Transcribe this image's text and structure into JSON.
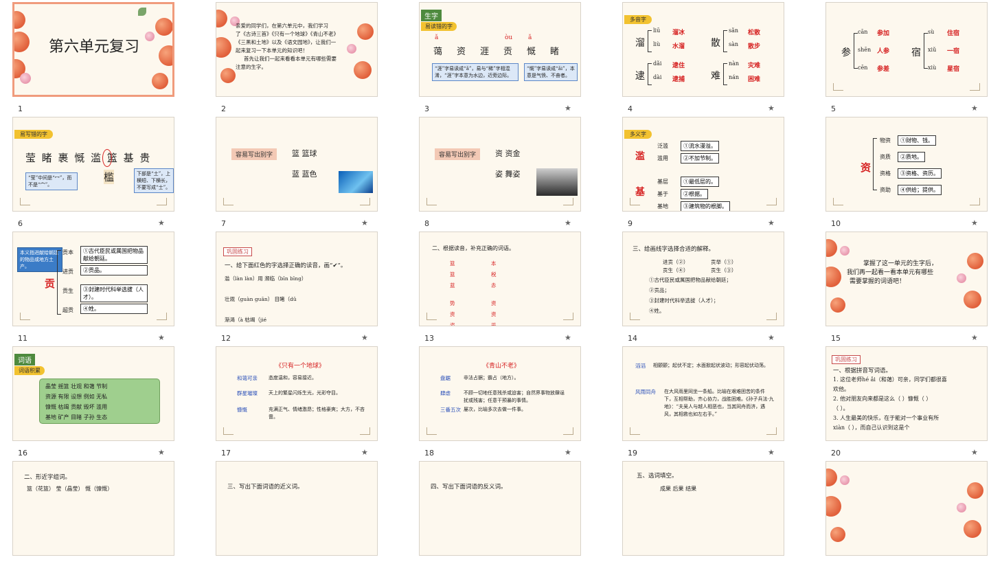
{
  "slides": [
    {
      "number": "1",
      "title": "第六单元复习",
      "selected": true
    },
    {
      "number": "2",
      "lines": [
        "亲爱的同学们，在第六单元中，我们学习",
        "了《古诗三首》《只有一个地球》《青山不老》",
        "《三黑和土地》以及《语文园地》，让我们一",
        "起来复习一下本单元的知识吧！",
        "首先让我们一起来看看本单元有哪些需要",
        "注意的生字。"
      ]
    },
    {
      "number": "3",
      "tag": "生字",
      "subtag": "易读错的字",
      "pinyin": [
        "ǎ",
        "",
        "",
        "òu",
        "ǎ",
        ""
      ],
      "chars": [
        "蔼",
        "资",
        "涯",
        "贡",
        "慨",
        "睹"
      ],
      "note1": "“涯”字易读成“ǎ”，易与“稀”字相混淆，“涯”字本意为水边，近旁边际。",
      "note2": "“慨”字易读成“ǎi”，本意是气愤、不奋者。"
    },
    {
      "number": "4",
      "tag": "多音字",
      "groups": [
        {
          "char": "溜",
          "items": [
            {
              "py": "liū",
              "word": "溜冰"
            },
            {
              "py": "liù",
              "word": "水溜"
            }
          ]
        },
        {
          "char": "散",
          "items": [
            {
              "py": "sǎn",
              "word": "松散"
            },
            {
              "py": "sàn",
              "word": "散步"
            }
          ]
        },
        {
          "char": "逮",
          "items": [
            {
              "py": "dǎi",
              "word": "逮住"
            },
            {
              "py": "dài",
              "word": "逮捕"
            }
          ]
        },
        {
          "char": "难",
          "items": [
            {
              "py": "nàn",
              "word": "灾难"
            },
            {
              "py": "nán",
              "word": "困难"
            }
          ]
        }
      ]
    },
    {
      "number": "5",
      "groups": [
        {
          "char": "参",
          "items": [
            {
              "py": "cān",
              "word": "参加"
            },
            {
              "py": "shēn",
              "word": "人参"
            },
            {
              "py": "cēn",
              "word": "参差"
            }
          ]
        },
        {
          "char": "宿",
          "items": [
            {
              "py": "sù",
              "word": "住宿"
            },
            {
              "py": "xiǔ",
              "word": "一宿"
            },
            {
              "py": "xiù",
              "word": "星宿"
            }
          ]
        }
      ]
    },
    {
      "number": "6",
      "subtag": "易写错的字",
      "chars": "莹 睹 裹 慨 滥 篮 基 贵",
      "note1": "“莹”中间是“冖”，而不是“宀”。",
      "note2": "下部是“土”，上横短、下横长，不要写成“士”。",
      "bigchar": "槛"
    },
    {
      "number": "7",
      "label": "容易写出别字",
      "line1": "篮  篮球",
      "line2": "蓝  蓝色"
    },
    {
      "number": "8",
      "label": "容易写出别字",
      "line1": "资  资金",
      "line2": "姿  舞姿"
    },
    {
      "number": "9",
      "tag": "多义字",
      "groups": [
        {
          "char": "滥",
          "items": [
            {
              "word": "泛滥",
              "meaning": "①流水漫溢。"
            },
            {
              "word": "滥用",
              "meaning": "②不加节制。"
            }
          ]
        },
        {
          "char": "基",
          "items": [
            {
              "word": "基层",
              "meaning": "①最低层的。"
            },
            {
              "word": "基于",
              "meaning": "②根据。"
            },
            {
              "word": "基地",
              "meaning": "③建筑物的根脚。"
            }
          ]
        }
      ]
    },
    {
      "number": "10",
      "char": "资",
      "items": [
        {
          "word": "物资",
          "meaning": "①财物、钱。"
        },
        {
          "word": "资质",
          "meaning": "②质地。"
        },
        {
          "word": "资格",
          "meaning": "③资格、资历。"
        },
        {
          "word": "资助",
          "meaning": "④供给；提供。"
        }
      ]
    },
    {
      "number": "11",
      "note": "本义指进献给朝廷的物品或地方土产。",
      "char": "贡",
      "items": [
        {
          "word": "贡本",
          "meaning": "①古代臣民或属国把物品献给朝廷。"
        },
        {
          "word": "进贡",
          "meaning": "②贡品。"
        },
        {
          "word": "贡生",
          "meaning": "③封建时代科举选拔（人才）。"
        },
        {
          "word": "超贡",
          "meaning": "④姓。"
        }
      ]
    },
    {
      "number": "12",
      "head": "巩固练习",
      "q": "一、给下面红色的字选择正确的读音，画“✔”。",
      "lines": [
        "滥（làn  làn）用        濒临（bīn  bīng）",
        "壮观（guàn  guān）  目睹（dǔ",
        "渐渴（à                  枯竭（jié"
      ]
    },
    {
      "number": "13",
      "q": "二、根据读音，补充正确的词语。",
      "answers": [
        "篮",
        "篮",
        "蓝",
        "本",
        "税",
        "赤",
        "势",
        "资",
        "姿",
        "资",
        "资",
        "妥"
      ]
    },
    {
      "number": "14",
      "q": "三、给画线字选择合适的解释。",
      "pairs": [
        [
          "进贡（②）",
          "贡举（①）"
        ],
        [
          "贡生（④）",
          "贡生（③）"
        ]
      ],
      "meanings": [
        "①古代臣民或属国把物品献给朝廷；",
        "②贡品；",
        "③封建时代科举选拔（人才）；",
        "④姓。"
      ]
    },
    {
      "number": "15",
      "lines": [
        "掌握了这一单元的生字后，",
        "我们再一起看一看本单元有哪些",
        "需要掌握的词语吧！"
      ]
    },
    {
      "number": "16",
      "tag": "词语",
      "subtag": "词语积累",
      "rows": [
        "晶莹  摇篮  壮观  和蔼  节制",
        "资源  有限  设想  例如  无私",
        "慷慨  枯竭  贡献  毁坏  滥用",
        "基地  矿产  目睹  子孙  生态"
      ]
    },
    {
      "number": "17",
      "title": "《只有一个地球》",
      "entries": [
        {
          "term": "和蔼可亲",
          "def": "态度温和，容易接近。"
        },
        {
          "term": "群星璀璨",
          "def": "天上的繁星闪烁生光，光彩夺目。"
        },
        {
          "term": "慷慨",
          "def": "充满正气、情绪激昂；性格豪爽；大方，不吝啬。"
        }
      ]
    },
    {
      "number": "18",
      "title": "《青山不老》",
      "entries": [
        {
          "term": "盘踞",
          "def": "非法占据；霸占（地方）。"
        },
        {
          "term": "肆虐",
          "def": "不顾一切地任意残杀或迫害；自然界事物放肆逞扰或残害；任意干预暴的事情。"
        },
        {
          "term": "三番五次",
          "def": "屡次，比喻多次去做一件事。"
        }
      ]
    },
    {
      "number": "19",
      "entries": [
        {
          "term": "滔滔",
          "def": "相颤颤；起伏不定；水面掀起状波动；形容起伏动荡。"
        },
        {
          "term": "风雨同舟",
          "def": "在大风雨里同坐一条船。比喻在艰难困苦的条件下，互相帮助，齐心协力，战胜困难。《孙子兵法·九地》：“夫吴人与越人相恶也，当其同舟而济，遇风，其相救也如左右手。”"
        }
      ]
    },
    {
      "number": "20",
      "head": "巩固练习",
      "q": "一、根据拼音写词语。",
      "lines": [
        "1. 这位老师hé ǎi（和蔼）可亲，同学们都很喜",
        "欢他。",
        "2. 他对朋友向来都是这么（  ）慷慨（  ）",
        "（    ）。",
        "3. 人生最美的快乐，在于能对一个事业有所",
        "xiàn（    ），而自己认识到这是个"
      ]
    },
    {
      "number": "",
      "q": "二、形近字组词。",
      "line": "篮（花篮）  莹（晶莹）  慨（慷慨）"
    },
    {
      "number": "",
      "q": "三、写出下面词语的近义词。"
    },
    {
      "number": "",
      "q": "四、写出下面词语的反义词。"
    },
    {
      "number": "",
      "q": "五、选词填空。",
      "line": "成果    后果    结果"
    },
    {
      "number": ""
    }
  ],
  "star_icon": "★",
  "colors": {
    "accent": "#f09b7c",
    "red": "#d62222",
    "blue": "#2a4fb8"
  }
}
